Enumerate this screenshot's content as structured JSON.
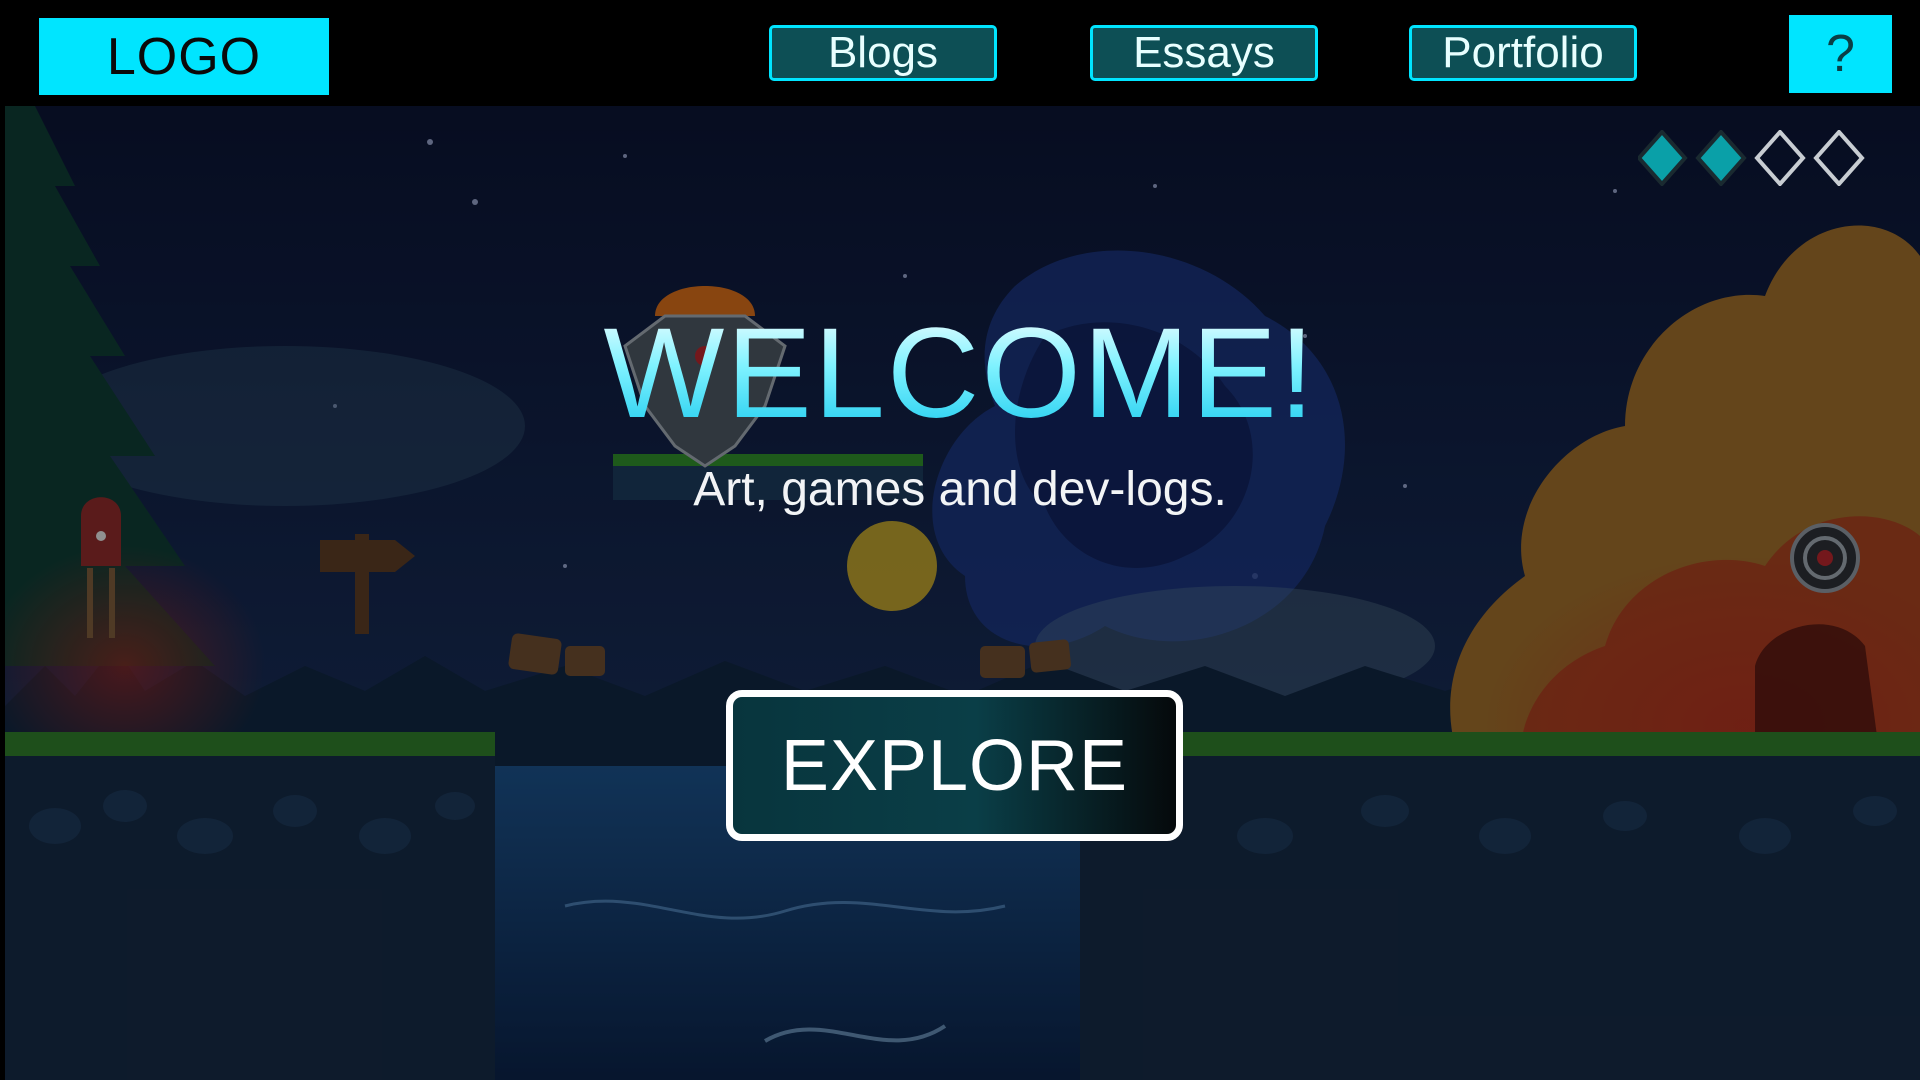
{
  "nav": {
    "logo": "LOGO",
    "links": [
      {
        "label": "Blogs"
      },
      {
        "label": "Essays"
      },
      {
        "label": "Portfolio"
      }
    ],
    "help": "?"
  },
  "hero": {
    "title": "WELCOME!",
    "subtitle": "Art, games and dev-logs.",
    "cta": "EXPLORE"
  },
  "progress": {
    "total": 4,
    "filled": 2,
    "icon": "diamond-icon"
  },
  "colors": {
    "accent": "#00e5ff",
    "nav_button_fill": "#0d4f55",
    "sky": "#0e1a3c",
    "cloud_fire": "#d79a3a"
  }
}
